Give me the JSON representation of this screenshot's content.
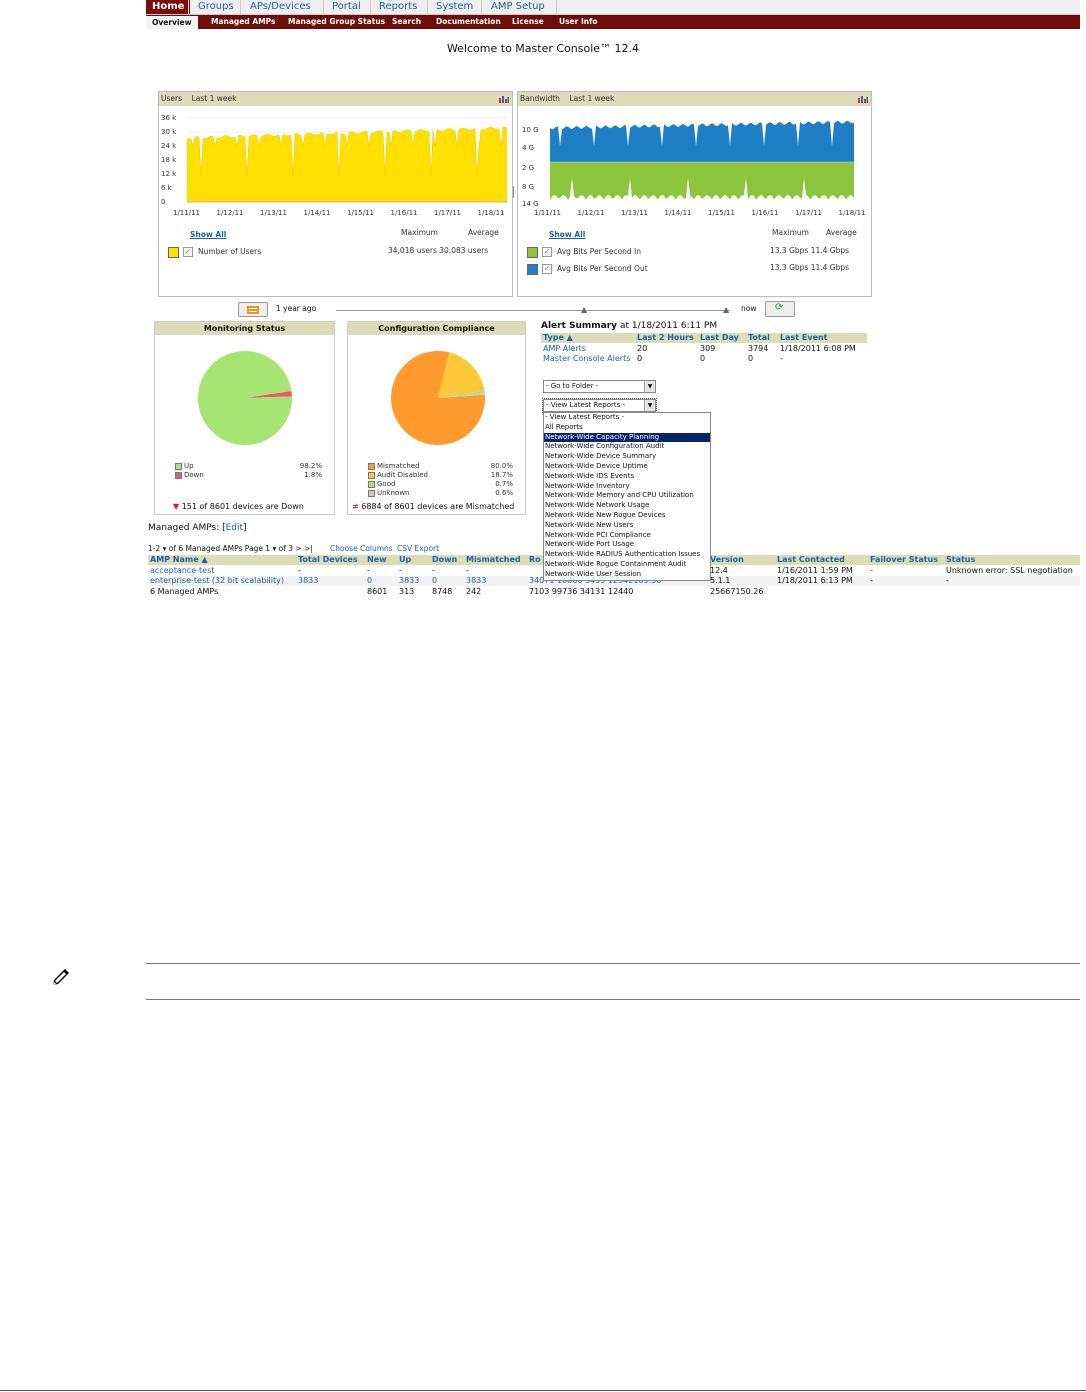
{
  "nav": {
    "top": [
      "Home",
      "Groups",
      "APs/Devices",
      "Portal",
      "Reports",
      "System",
      "AMP Setup"
    ],
    "sub": [
      "Overview",
      "Managed AMPs",
      "Managed Group Status",
      "Search",
      "Documentation",
      "License",
      "User Info"
    ]
  },
  "welcome": "Welcome to Master Console™ 12.4",
  "users_chart": {
    "title": "Users",
    "range": "Last 1 week",
    "yticks": [
      "36 k",
      "30 k",
      "24 k",
      "18 k",
      "12 k",
      "6 k",
      "0"
    ],
    "xticks": [
      "1/11/11",
      "1/12/11",
      "1/13/11",
      "1/14/11",
      "1/15/11",
      "1/16/11",
      "1/17/11",
      "1/18/11"
    ],
    "show_all": "Show All",
    "col_max": "Maximum",
    "col_avg": "Average",
    "series_label": "Number of Users",
    "series_values": "34,018 users 30,083 users",
    "color": "#ffe000"
  },
  "bandwidth_chart": {
    "title": "Bandwidth",
    "range": "Last 1 week",
    "yticks": [
      "10 G",
      "4 G",
      "2 G",
      "8 G",
      "14 G"
    ],
    "xticks": [
      "1/11/11",
      "1/12/11",
      "1/13/11",
      "1/14/11",
      "1/15/11",
      "1/16/11",
      "1/17/11",
      "1/18/11"
    ],
    "show_all": "Show All",
    "col_max": "Maximum",
    "col_avg": "Average",
    "series": [
      {
        "label": "Avg Bits Per Second In",
        "values": "13.3 Gbps 11.4 Gbps",
        "color": "#8cc63f"
      },
      {
        "label": "Avg Bits Per Second Out",
        "values": "13.3 Gbps 11.4 Gbps",
        "color": "#1f7fc4"
      }
    ]
  },
  "timeline": {
    "left": "1 year ago",
    "right": "now"
  },
  "monitoring": {
    "title": "Monitoring Status",
    "legend": [
      {
        "label": "Up",
        "value": "98.2%",
        "color": "#a6e571"
      },
      {
        "label": "Down",
        "value": "1.8%",
        "color": "#f0566b"
      }
    ],
    "footer": "151 of 8601 devices are Down"
  },
  "compliance": {
    "title": "Configuration Compliance",
    "legend": [
      {
        "label": "Mismatched",
        "value": "80.0%",
        "color": "#ff9a2e"
      },
      {
        "label": "Audit Disabled",
        "value": "18.7%",
        "color": "#ffc83a"
      },
      {
        "label": "Good",
        "value": "0.7%",
        "color": "#a6e571"
      },
      {
        "label": "Unknown",
        "value": "0.6%",
        "color": "#c8c8c8"
      }
    ],
    "footer": "6884 of 8601 devices are Mismatched"
  },
  "alerts": {
    "title": "Alert Summary",
    "time": "at 1/18/2011 6:11 PM",
    "headers": [
      "Type ▲",
      "Last 2 Hours",
      "Last Day",
      "Total",
      "Last Event"
    ],
    "rows": [
      [
        "AMP Alerts",
        "20",
        "309",
        "3794",
        "1/18/2011 6:08 PM"
      ],
      [
        "Master Console Alerts",
        "0",
        "0",
        "0",
        "-"
      ]
    ]
  },
  "folder_select": "- Go to Folder -",
  "reports_select": "- View Latest Reports -",
  "reports_options": [
    "- View Latest Reports -",
    "All Reports",
    "Network-Wide Capacity Planning",
    "Network-Wide Configuration Audit",
    "Network-Wide Device Summary",
    "Network-Wide Device Uptime",
    "Network-Wide IDS Events",
    "Network-Wide Inventory",
    "Network-Wide Memory and CPU Utilization",
    "Network-Wide Network Usage",
    "Network-Wide New Rogue Devices",
    "Network-Wide New Users",
    "Network-Wide PCI Compliance",
    "Network-Wide Port Usage",
    "Network-Wide RADIUS Authentication Issues",
    "Network-Wide Rogue Containment Audit",
    "Network-Wide User Session"
  ],
  "managed": {
    "title": "Managed AMPs:",
    "edit": "Edit",
    "pager": "1-2 ▾ of 6 Managed AMPs  Page 1 ▾ of 3  >  >|",
    "choose": "Choose Columns",
    "csv": "CSV Export",
    "headers": [
      "AMP Name ▲",
      "Total Devices",
      "New",
      "Up",
      "Down",
      "Mismatched",
      "Ro",
      "Version",
      "Last Contacted",
      "Failover Status",
      "Status"
    ],
    "rows": [
      [
        "acceptance-test",
        "-",
        "-",
        "-",
        "-",
        "-",
        "",
        "12.4",
        "1/16/2011 1:59 PM",
        "-",
        "Unknown error: SSL negotiation"
      ],
      [
        "enterprise-test (32 bit scalability)",
        "3833",
        "0",
        "3833",
        "0",
        "3833",
        "34071   10860   3499   12342109.30",
        "5.1.1",
        "1/18/2011 6:13 PM",
        "-",
        "-"
      ]
    ],
    "total": [
      "6 Managed AMPs",
      "8601",
      "313",
      "8748",
      "242",
      "7103   99736   34131   12440",
      "25667150.26"
    ]
  }
}
